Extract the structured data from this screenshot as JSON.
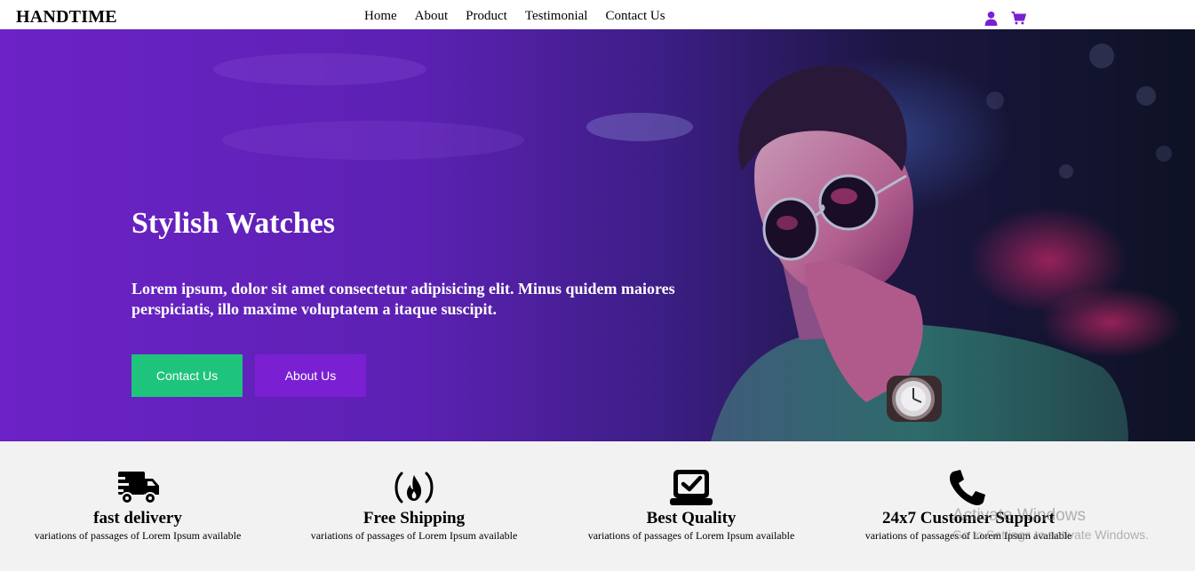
{
  "navbar": {
    "logo": "HANDTIME",
    "links": [
      "Home",
      "About",
      "Product",
      "Testimonial",
      "Contact Us"
    ],
    "icons": [
      "user-icon",
      "cart-icon"
    ],
    "accent_color": "#7a1fd1"
  },
  "hero": {
    "title": "Stylish Watches",
    "text": "Lorem ipsum, dolor sit amet consectetur adipisicing elit. Minus quidem maiores perspiciatis, illo maxime voluptatem a itaque suscipit.",
    "buttons": {
      "contact": "Contact Us",
      "about": "About Us"
    },
    "colors": {
      "contact_button": "#1ec47b",
      "about_button": "#7a1fd1"
    }
  },
  "features": [
    {
      "icon": "truck-icon",
      "title": "fast delivery",
      "text": "variations of passages of Lorem Ipsum available"
    },
    {
      "icon": "fire-icon",
      "title": "Free Shipping",
      "text": "variations of passages of Lorem Ipsum available"
    },
    {
      "icon": "check-box-icon",
      "title": "Best Quality",
      "text": "variations of passages of Lorem Ipsum available"
    },
    {
      "icon": "phone-icon",
      "title": "24x7 Customer Support",
      "text": "variations of passages of Lorem Ipsum available"
    }
  ],
  "watermark": {
    "line1": "Activate Windows",
    "line2": "Go to Settings to activate Windows."
  }
}
